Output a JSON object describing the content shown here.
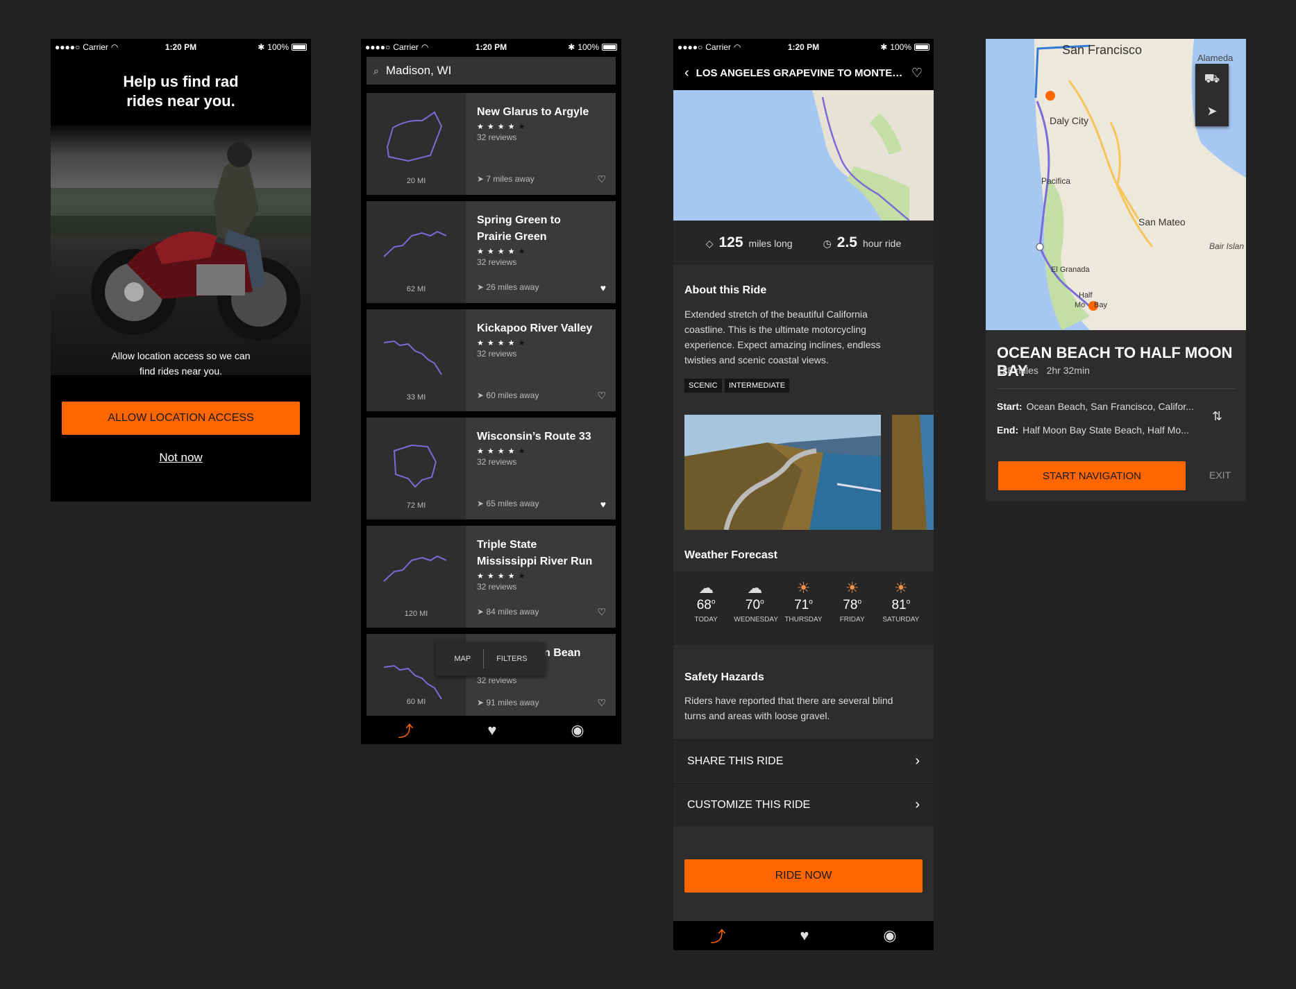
{
  "status": {
    "carrier": "Carrier",
    "time": "1:20 PM",
    "battery": "100%"
  },
  "screen1": {
    "title_line1": "Help us find rad",
    "title_line2": "rides near you.",
    "caption_line1": "Allow location access so we can",
    "caption_line2": "find rides near you.",
    "allow_label": "ALLOW LOCATION ACCESS",
    "not_now_label": "Not now"
  },
  "screen2": {
    "search_value": "Madison, WI",
    "rides": [
      {
        "name": "New Glarus to Argyle",
        "rating": 4,
        "reviews": "32 reviews",
        "distance": "7 miles away",
        "miles": "20 MI",
        "favorite": false
      },
      {
        "name": "Spring Green to Prairie Green",
        "rating": 4,
        "reviews": "32 reviews",
        "distance": "26 miles away",
        "miles": "62 MI",
        "favorite": true
      },
      {
        "name": "Kickapoo River Valley",
        "rating": 4,
        "reviews": "32 reviews",
        "distance": "60 miles away",
        "miles": "33 MI",
        "favorite": false
      },
      {
        "name": "Wisconsin’s Route 33",
        "rating": 4,
        "reviews": "32 reviews",
        "distance": "65 miles away",
        "miles": "72 MI",
        "favorite": true
      },
      {
        "name": "Triple State Mississippi River Run",
        "rating": 4,
        "reviews": "32 reviews",
        "distance": "84 miles away",
        "miles": "120 MI",
        "favorite": false
      },
      {
        "name": "n Bean",
        "rating": 4,
        "reviews": "32 reviews",
        "distance": "91 miles away",
        "miles": "60 MI",
        "favorite": false
      }
    ],
    "map_label": "MAP",
    "filters_label": "FILTERS"
  },
  "screen3": {
    "title": "LOS ANGELES GRAPEVINE TO MONTEREY C...",
    "miles_value": "125",
    "miles_label": "miles long",
    "hours_value": "2.5",
    "hours_label": "hour ride",
    "about_heading": "About this Ride",
    "about_text": "Extended stretch of the beautiful California coastline. This is the ultimate motorcycling experience. Expect amazing inclines, endless twisties and scenic coastal views.",
    "tags": [
      "SCENIC",
      "INTERMEDIATE"
    ],
    "weather_heading": "Weather Forecast",
    "forecast": [
      {
        "temp": "68",
        "day": "TODAY",
        "icon": "cloud-icon"
      },
      {
        "temp": "70",
        "day": "WEDNESDAY",
        "icon": "cloud-icon"
      },
      {
        "temp": "71",
        "day": "THURSDAY",
        "icon": "sun-icon"
      },
      {
        "temp": "78",
        "day": "FRIDAY",
        "icon": "sun-icon"
      },
      {
        "temp": "81",
        "day": "SATURDAY",
        "icon": "sun-icon"
      }
    ],
    "degree_mark": "o",
    "safety_heading": "Safety Hazards",
    "safety_text": "Riders have reported that there are several blind turns and areas with loose gravel.",
    "share_label": "SHARE THIS RIDE",
    "customize_label": "CUSTOMIZE THIS RIDE",
    "ride_now_label": "RIDE NOW"
  },
  "screen4": {
    "map_labels": [
      "San Francisco",
      "Alameda",
      "Daly City",
      "Pacifica",
      "San Mateo",
      "Bair Islan",
      "El Granada",
      "Half",
      "Mo",
      "Bay"
    ],
    "title": "OCEAN BEACH TO HALF MOON BAY",
    "miles": "128 miles",
    "duration": "2hr 32min",
    "start_label": "Start:",
    "start_value": "Ocean Beach, San Francisco, Califor...",
    "end_label": "End:",
    "end_value": "Half Moon Bay State Beach, Half Mo...",
    "start_nav_label": "START NAVIGATION",
    "exit_label": "EXIT"
  },
  "colors": {
    "accent": "#ff6600",
    "background": "#222222",
    "route": "#7a6cd6"
  }
}
